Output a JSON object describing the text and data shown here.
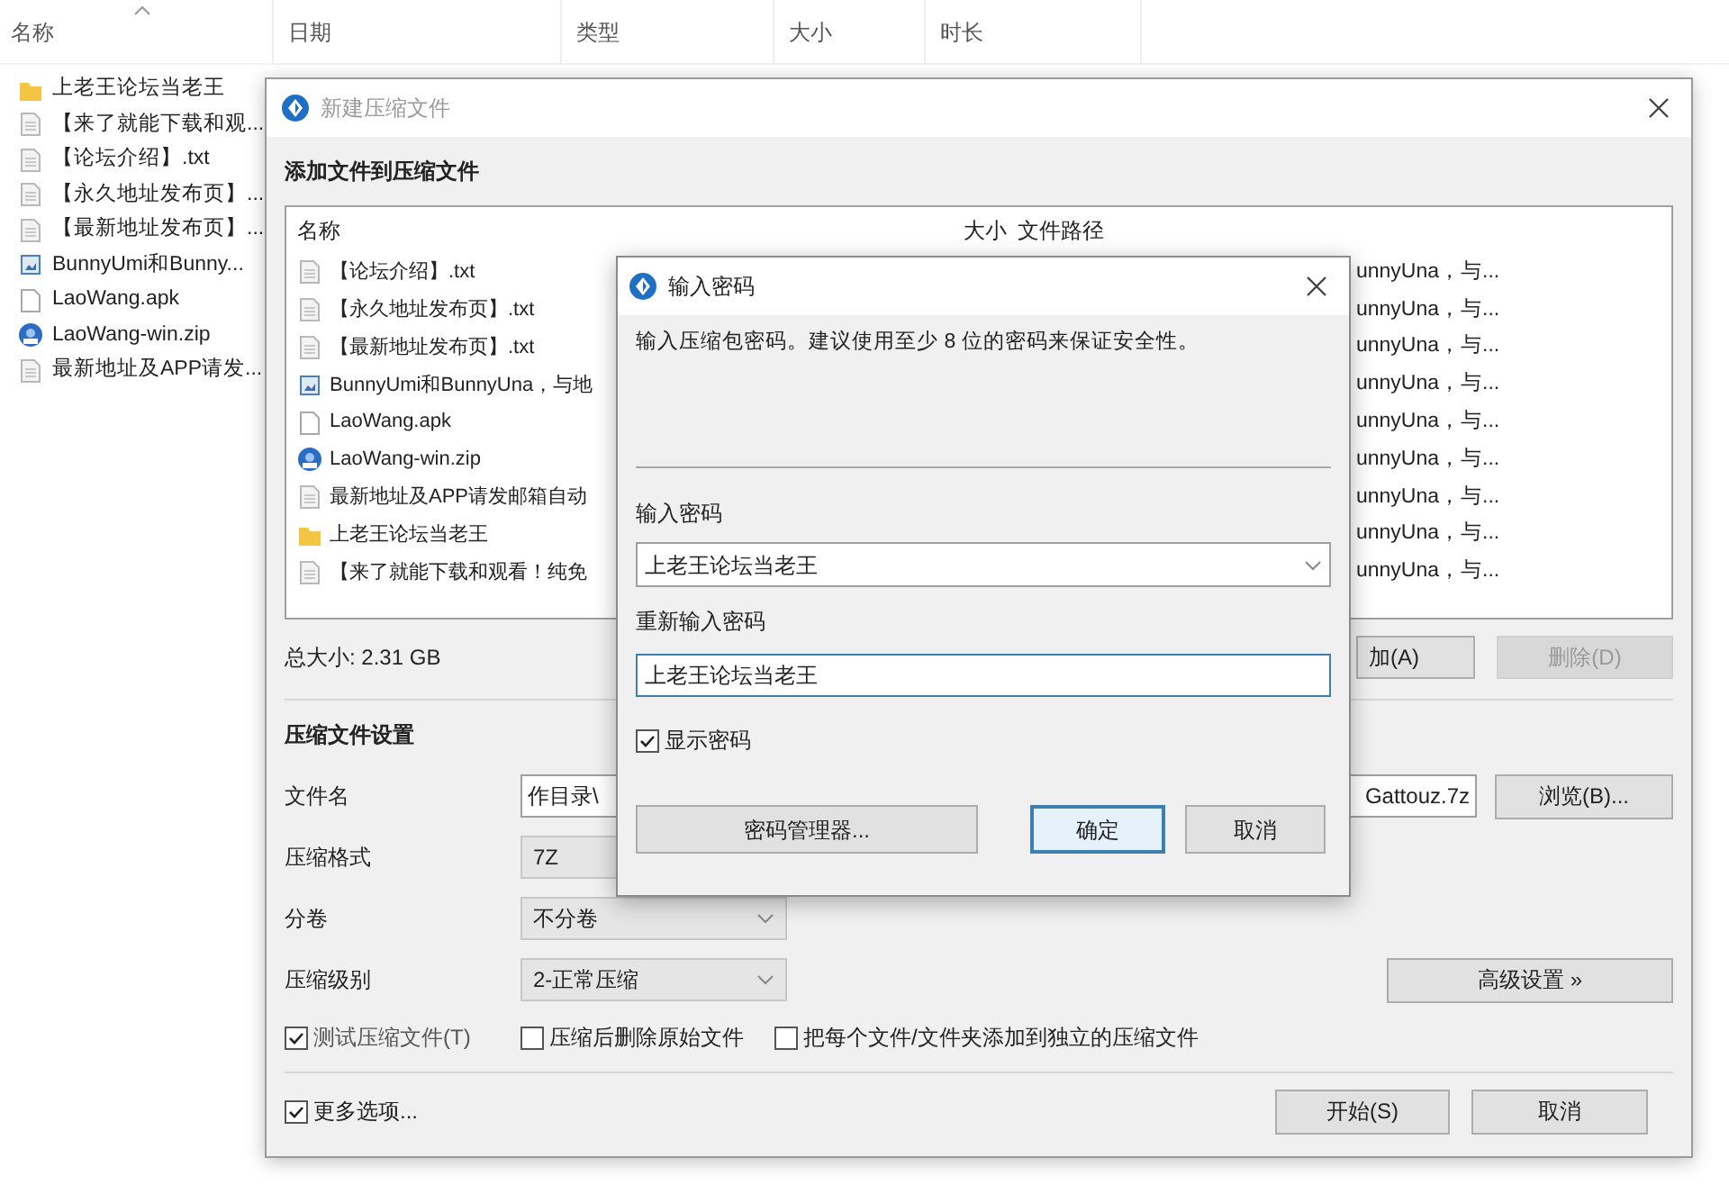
{
  "explorer": {
    "columns": [
      "名称",
      "日期",
      "类型",
      "大小",
      "时长"
    ],
    "files": [
      {
        "name": "上老王论坛当老王",
        "kind": "folder"
      },
      {
        "name": "【来了就能下载和观...",
        "kind": "text"
      },
      {
        "name": "【论坛介绍】.txt",
        "kind": "text"
      },
      {
        "name": "【永久地址发布页】...",
        "kind": "text"
      },
      {
        "name": "【最新地址发布页】...",
        "kind": "text"
      },
      {
        "name": "BunnyUmi和Bunny...",
        "kind": "image"
      },
      {
        "name": "LaoWang.apk",
        "kind": "blank"
      },
      {
        "name": "LaoWang-win.zip",
        "kind": "app"
      },
      {
        "name": "最新地址及APP请发...",
        "kind": "text"
      }
    ]
  },
  "compress_dialog": {
    "title": "新建压缩文件",
    "active": false,
    "section_title": "添加文件到压缩文件",
    "file_list": {
      "columns": [
        "名称",
        "大小",
        "文件路径"
      ],
      "rows": [
        {
          "name": "【论坛介绍】.txt",
          "kind": "text",
          "path": "unnyUna，与..."
        },
        {
          "name": "【永久地址发布页】.txt",
          "kind": "text",
          "path": "unnyUna，与..."
        },
        {
          "name": "【最新地址发布页】.txt",
          "kind": "text",
          "path": "unnyUna，与..."
        },
        {
          "name": "BunnyUmi和BunnyUna，与地",
          "kind": "image",
          "path": "unnyUna，与..."
        },
        {
          "name": "LaoWang.apk",
          "kind": "blank",
          "path": "unnyUna，与..."
        },
        {
          "name": "LaoWang-win.zip",
          "kind": "app",
          "path": "unnyUna，与..."
        },
        {
          "name": "最新地址及APP请发邮箱自动",
          "kind": "text",
          "path": "unnyUna，与..."
        },
        {
          "name": "上老王论坛当老王",
          "kind": "folder",
          "path": "unnyUna，与..."
        },
        {
          "name": "【来了就能下载和观看！纯免",
          "kind": "text",
          "path": "unnyUna，与..."
        }
      ]
    },
    "total_size": "总大小: 2.31 GB",
    "add_button": {
      "label": "加(A)",
      "disabled": false
    },
    "delete_button": {
      "label": "删除(D)",
      "disabled": true
    },
    "settings_title": "压缩文件设置",
    "fields": [
      {
        "label": "文件名",
        "kind": "text",
        "value_left": "作目录\\",
        "value_right": "Gattouz.7z"
      },
      {
        "label": "压缩格式",
        "kind": "select",
        "value": "7Z"
      },
      {
        "label": "分卷",
        "kind": "select",
        "value": "不分卷"
      },
      {
        "label": "压缩级别",
        "kind": "select",
        "value": "2-正常压缩"
      }
    ],
    "browse_button": "浏览(B)...",
    "advanced_button": "高级设置 »",
    "options": [
      {
        "label": "测试压缩文件(T)",
        "checked": true
      },
      {
        "label": "压缩后删除原始文件",
        "checked": false
      },
      {
        "label": "把每个文件/文件夹添加到独立的压缩文件",
        "checked": false
      }
    ],
    "more_options": {
      "label": "更多选项...",
      "checked": true
    },
    "start_button": "开始(S)",
    "cancel_button": "取消"
  },
  "password_dialog": {
    "title": "输入密码",
    "active": true,
    "hint": "输入压缩包密码。建议使用至少 8 位的密码来保证安全性。",
    "password_label": "输入密码",
    "password_value": "上老王论坛当老王",
    "confirm_label": "重新输入密码",
    "confirm_value": "上老王论坛当老王",
    "show_password": {
      "label": "显示密码",
      "checked": true
    },
    "manager_button": "密码管理器...",
    "ok_button": "确定",
    "cancel_button": "取消"
  }
}
